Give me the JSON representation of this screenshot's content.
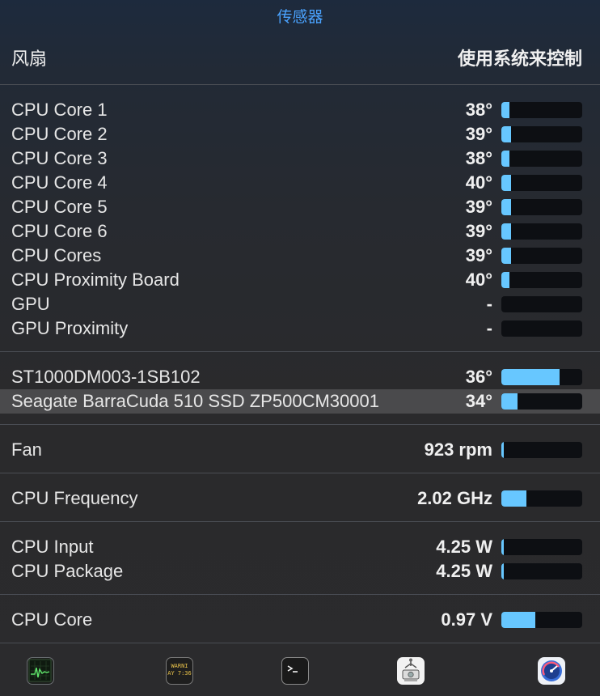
{
  "title": "传感器",
  "header": {
    "left": "风扇",
    "right": "使用系统来控制"
  },
  "colors": {
    "accent": "#4aa3ff",
    "bar_fill": "#67c7ff",
    "bar_track": "#0d0f13"
  },
  "temperatures": [
    {
      "label": "CPU Core 1",
      "value": "38°",
      "level": 0.1
    },
    {
      "label": "CPU Core 2",
      "value": "39°",
      "level": 0.12
    },
    {
      "label": "CPU Core 3",
      "value": "38°",
      "level": 0.1
    },
    {
      "label": "CPU Core 4",
      "value": "40°",
      "level": 0.12
    },
    {
      "label": "CPU Core 5",
      "value": "39°",
      "level": 0.12
    },
    {
      "label": "CPU Core 6",
      "value": "39°",
      "level": 0.12
    },
    {
      "label": "CPU Cores",
      "value": "39°",
      "level": 0.12
    },
    {
      "label": "CPU Proximity Board",
      "value": "40°",
      "level": 0.1
    },
    {
      "label": "GPU",
      "value": "-",
      "level": 0
    },
    {
      "label": "GPU Proximity",
      "value": "-",
      "level": 0
    }
  ],
  "drives": [
    {
      "label": "ST1000DM003-1SB102",
      "value": "36°",
      "level": 0.72
    },
    {
      "label": "Seagate BarraCuda 510 SSD ZP500CM30001",
      "value": "34°",
      "level": 0.2
    }
  ],
  "fans": [
    {
      "label": "Fan",
      "value": "923 rpm",
      "level": 0.02
    }
  ],
  "frequency": [
    {
      "label": "CPU Frequency",
      "value": "2.02 GHz",
      "level": 0.31
    }
  ],
  "power": [
    {
      "label": "CPU Input",
      "value": "4.25 W",
      "level": 0.02
    },
    {
      "label": "CPU Package",
      "value": "4.25 W",
      "level": 0.02
    }
  ],
  "voltage": [
    {
      "label": "CPU Core",
      "value": "0.97 V",
      "level": 0.42
    }
  ],
  "dock": [
    {
      "icon": "activity-monitor-icon"
    },
    {
      "icon": "console-icon",
      "text": "WARNI\nAY 7:36"
    },
    {
      "icon": "terminal-icon"
    },
    {
      "icon": "disk-utility-icon"
    },
    {
      "icon": "istat-menus-icon"
    }
  ]
}
